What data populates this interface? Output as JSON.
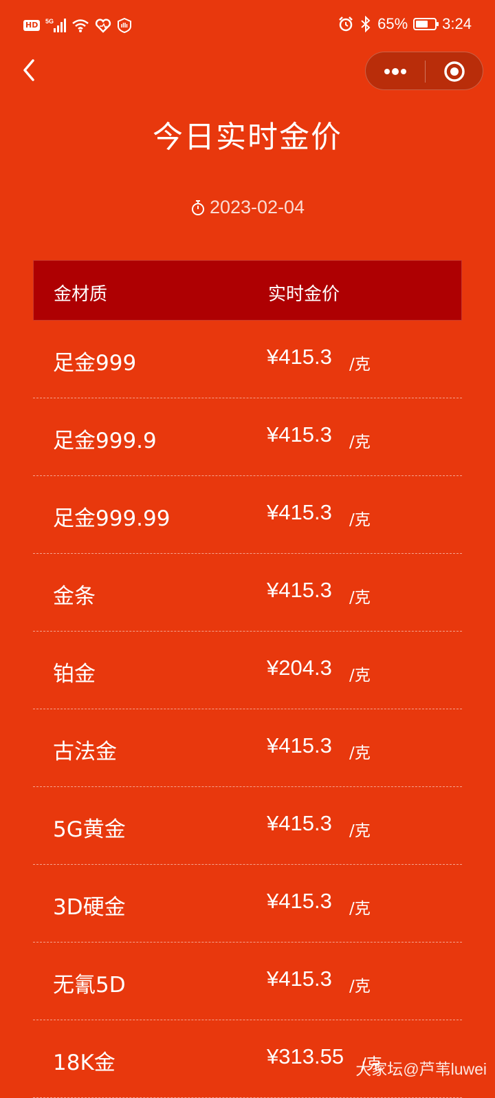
{
  "status_bar": {
    "hd_label": "HD",
    "network_label": "5G",
    "battery_percent_text": "65%",
    "battery_level": 0.65,
    "time": "3:24",
    "icons": [
      "signal-icon",
      "wifi-icon",
      "heart-icon",
      "shield-icon",
      "alarm-icon",
      "bluetooth-icon",
      "battery-icon"
    ]
  },
  "nav": {
    "back_icon": "chevron-left-icon",
    "more_icon": "more-dots-icon",
    "close_icon": "target-circle-icon"
  },
  "page": {
    "title": "今日实时金价",
    "date": "2023-02-04",
    "date_icon": "stopwatch-icon"
  },
  "table": {
    "headers": {
      "material": "金材质",
      "price": "实时金价"
    },
    "rows": [
      {
        "name": "足金999",
        "price": "¥415.3",
        "unit": "/克"
      },
      {
        "name": "足金999.9",
        "price": "¥415.3",
        "unit": "/克"
      },
      {
        "name": "足金999.99",
        "price": "¥415.3",
        "unit": "/克"
      },
      {
        "name": "金条",
        "price": "¥415.3",
        "unit": "/克"
      },
      {
        "name": "铂金",
        "price": "¥204.3",
        "unit": "/克"
      },
      {
        "name": "古法金",
        "price": "¥415.3",
        "unit": "/克"
      },
      {
        "name": "5G黄金",
        "price": "¥415.3",
        "unit": "/克"
      },
      {
        "name": "3D硬金",
        "price": "¥415.3",
        "unit": "/克"
      },
      {
        "name": "无氰5D",
        "price": "¥415.3",
        "unit": "/克"
      },
      {
        "name": "18K金",
        "price": "¥313.55",
        "unit": "/克"
      }
    ]
  },
  "watermark": "大家坛@芦苇luwei",
  "colors": {
    "background": "#E8380D",
    "header_bg": "#AE0002",
    "capsule_bg": "#B92D0A",
    "text": "#FFFFFF"
  }
}
